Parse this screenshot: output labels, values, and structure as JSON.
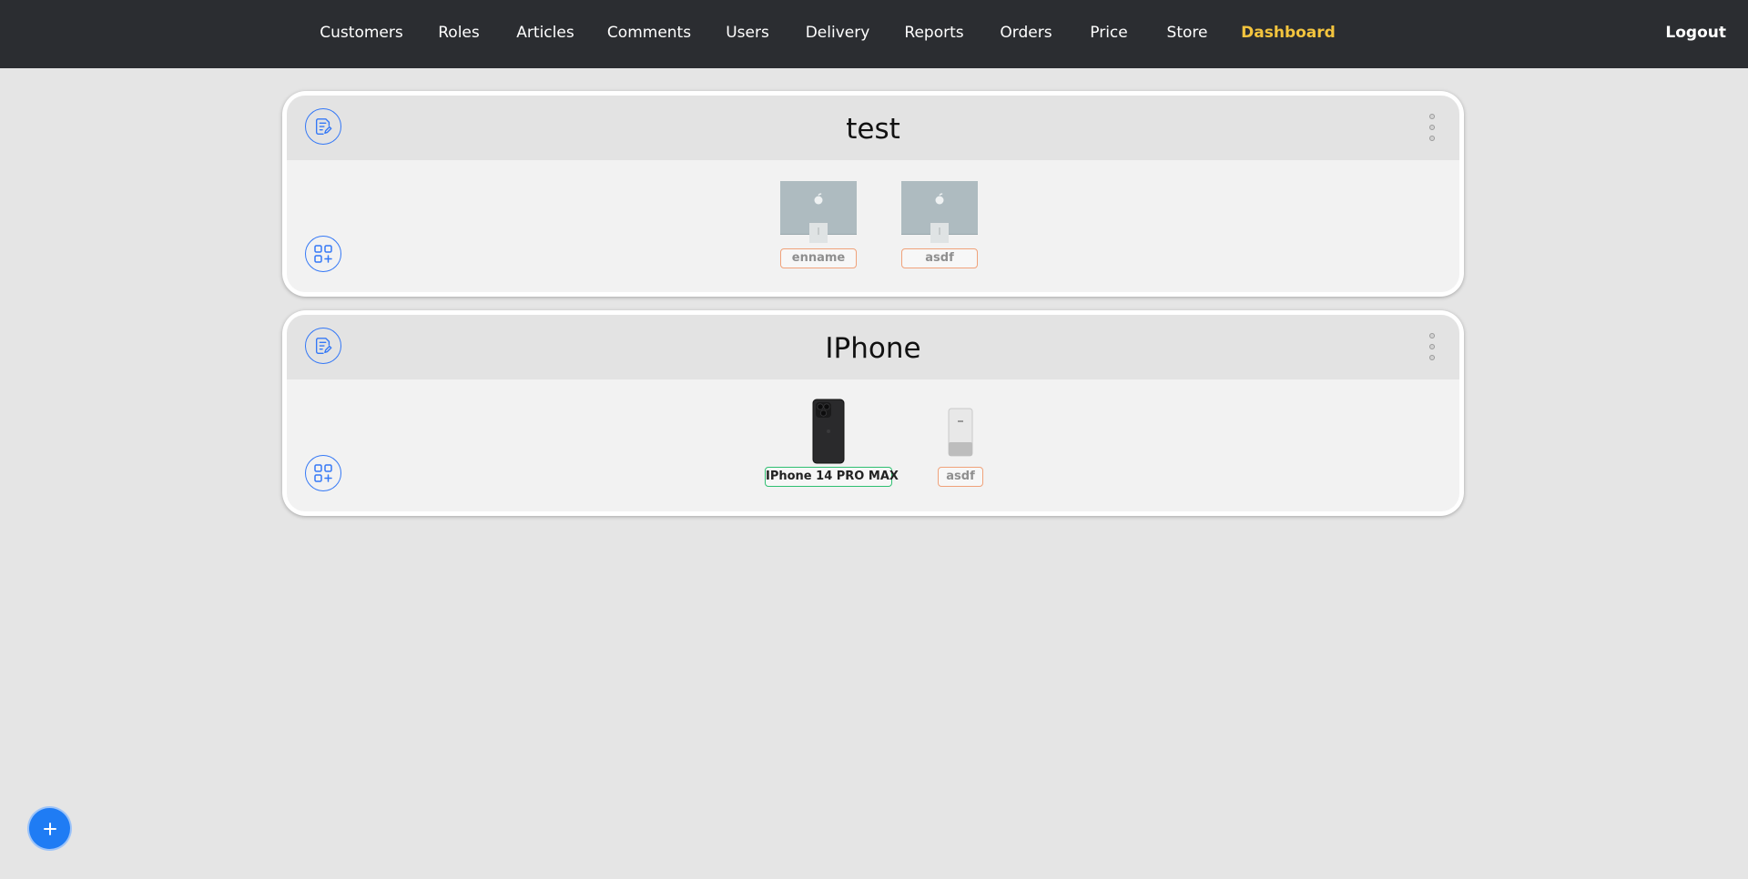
{
  "nav": {
    "items": [
      {
        "label": "Customers",
        "active": false
      },
      {
        "label": "Roles",
        "active": false
      },
      {
        "label": "Articles",
        "active": false
      },
      {
        "label": "Comments",
        "active": false
      },
      {
        "label": "Users",
        "active": false
      },
      {
        "label": "Delivery",
        "active": false
      },
      {
        "label": "Reports",
        "active": false
      },
      {
        "label": "Orders",
        "active": false
      },
      {
        "label": "Price",
        "active": false
      },
      {
        "label": "Store",
        "active": false
      },
      {
        "label": "Dashboard",
        "active": true
      }
    ],
    "logout": "Logout",
    "active_color": "#f3c43e",
    "background": "#2b2d31"
  },
  "categories": [
    {
      "title": "test",
      "products": [
        {
          "name": "enname",
          "image": "imac-icon",
          "status": "warning"
        },
        {
          "name": "asdf",
          "image": "imac-icon",
          "status": "warning"
        }
      ]
    },
    {
      "title": "IPhone",
      "products": [
        {
          "name": "IPhone 14 PRO MAX",
          "image": "iphone-icon",
          "status": "ok"
        },
        {
          "name": "asdf",
          "image": "iphone-classic-icon",
          "status": "warning"
        }
      ]
    }
  ],
  "icons": {
    "edit": "note-edit-icon",
    "add_product": "grid-add-icon",
    "menu": "kebab-menu-icon",
    "fab": "plus-icon"
  },
  "colors": {
    "accent": "#3478f6",
    "fab": "#1f7cf4",
    "warning_border": "#f0a27a",
    "ok_border": "#2fbf71"
  }
}
